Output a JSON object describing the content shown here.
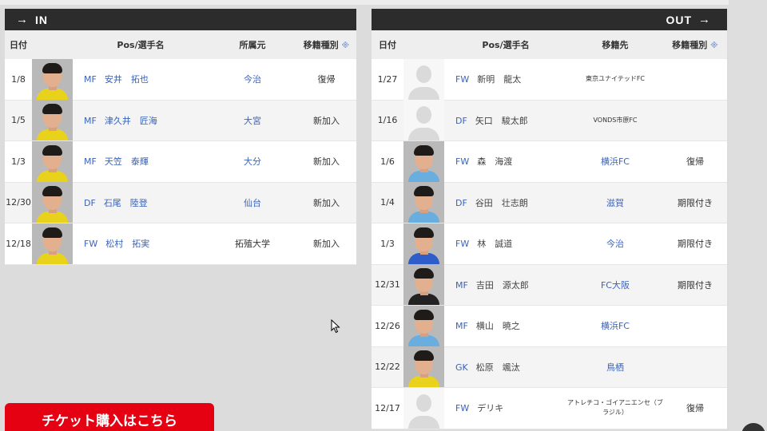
{
  "in_panel": {
    "title": "IN",
    "headers": {
      "date": "日付",
      "name": "Pos/選手名",
      "club": "所属元",
      "type": "移籍種別",
      "note": "※"
    },
    "rows": [
      {
        "date": "1/8",
        "pos": "MF",
        "name": "安井　拓也",
        "club": "今治",
        "type": "復帰",
        "photo": "player-photo"
      },
      {
        "date": "1/5",
        "pos": "MF",
        "name": "津久井　匠海",
        "club": "大宮",
        "type": "新加入",
        "photo": "player-photo"
      },
      {
        "date": "1/3",
        "pos": "MF",
        "name": "天笠　泰輝",
        "club": "大分",
        "type": "新加入",
        "photo": "player-photo"
      },
      {
        "date": "12/30",
        "pos": "DF",
        "name": "石尾　陸登",
        "club": "仙台",
        "type": "新加入",
        "photo": "player-photo"
      },
      {
        "date": "12/18",
        "pos": "FW",
        "name": "松村　拓実",
        "club": "拓殖大学",
        "type": "新加入",
        "photo": "player-photo"
      }
    ]
  },
  "out_panel": {
    "title": "OUT",
    "headers": {
      "date": "日付",
      "name": "Pos/選手名",
      "club": "移籍先",
      "type": "移籍種別",
      "note": "※"
    },
    "rows": [
      {
        "date": "1/27",
        "pos": "FW",
        "name": "新明　龍太",
        "club": "東京ユナイテッドFC",
        "type": ""
      },
      {
        "date": "1/16",
        "pos": "DF",
        "name": "矢口　駿太郎",
        "club": "VONDS市原FC",
        "type": ""
      },
      {
        "date": "1/6",
        "pos": "FW",
        "name": "森　海渡",
        "club": "横浜FC",
        "type": "復帰"
      },
      {
        "date": "1/4",
        "pos": "DF",
        "name": "谷田　壮志朗",
        "club": "滋賀",
        "type": "期限付き"
      },
      {
        "date": "1/3",
        "pos": "FW",
        "name": "林　誠道",
        "club": "今治",
        "type": "期限付き"
      },
      {
        "date": "12/31",
        "pos": "MF",
        "name": "吉田　源太郎",
        "club": "FC大阪",
        "type": "期限付き"
      },
      {
        "date": "12/26",
        "pos": "MF",
        "name": "横山　暁之",
        "club": "横浜FC",
        "type": ""
      },
      {
        "date": "12/22",
        "pos": "GK",
        "name": "松原　颯汰",
        "club": "鳥栖",
        "type": ""
      },
      {
        "date": "12/17",
        "pos": "FW",
        "name": "デリキ",
        "club": "アトレチコ・ゴイアニエンセ（ブラジル）",
        "type": "復帰"
      }
    ]
  },
  "ticket_button": {
    "label": "チケット購入はこちら"
  },
  "colors": {
    "accent_red": "#e50012",
    "header_bar": "#2c2c2c",
    "link_blue": "#3a63b8",
    "kit_yellow": "#e8d21c",
    "kit_sky": "#6aaee0"
  },
  "icons": {
    "in_arrow": "arrow-right-icon",
    "out_arrow": "arrow-right-icon",
    "cursor": "mouse-cursor-icon"
  }
}
